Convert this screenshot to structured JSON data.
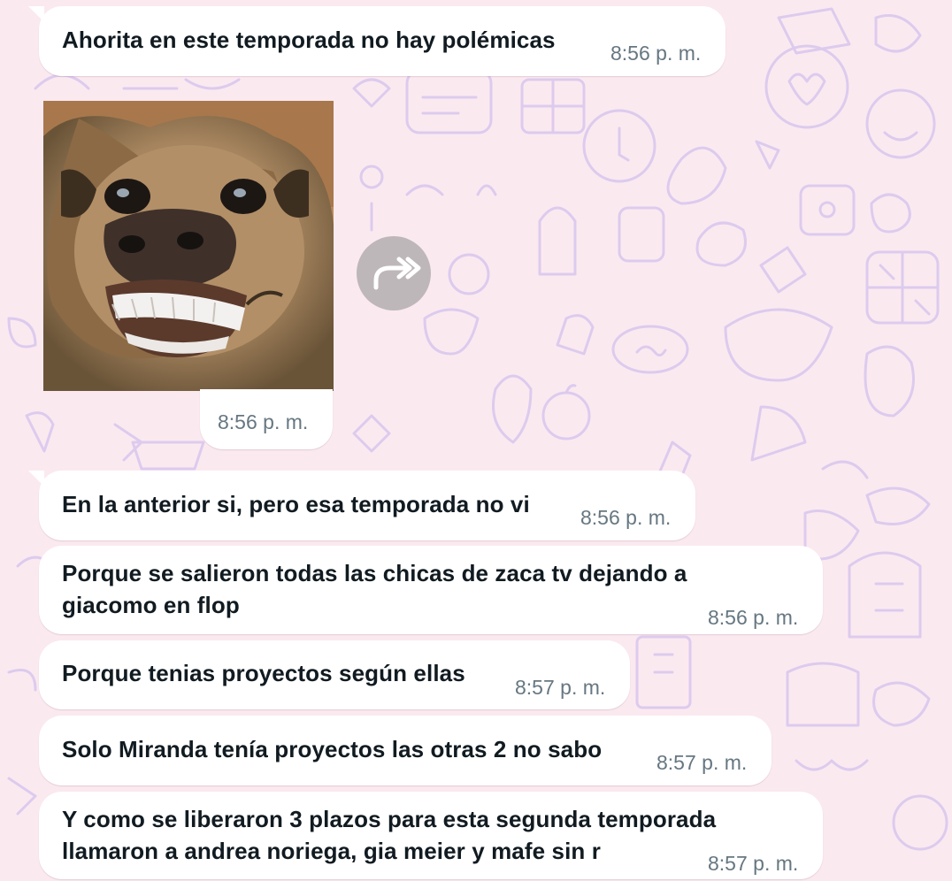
{
  "messages": [
    {
      "text": "Ahorita en este temporada no hay polémicas",
      "time": "8:56 p. m."
    },
    {
      "type": "image",
      "image": "smiling-dog-photo",
      "time": "8:56 p. m."
    },
    {
      "text": "En la anterior si, pero esa temporada no vi",
      "time": "8:56 p. m."
    },
    {
      "lines": [
        "Porque se salieron todas las chicas de zaca tv dejando a",
        "giacomo en flop"
      ],
      "time": "8:56 p. m."
    },
    {
      "text": "Porque tenias proyectos según ellas",
      "time": "8:57 p. m."
    },
    {
      "text": "Solo Miranda tenía proyectos las otras 2 no sabo",
      "time": "8:57 p. m."
    },
    {
      "lines": [
        "Y como se liberaron 3 plazos para esta segunda temporada",
        "llamaron a andrea noriega, gia meier y mafe sin r"
      ],
      "time": "8:57 p. m."
    }
  ],
  "icons": {
    "forward": "forward-arrow-icon"
  },
  "colors": {
    "wallpaper": "#fbe9f0",
    "doodle": "#d9c8ec",
    "bubble": "#ffffff",
    "text": "#111b21",
    "time": "#667781",
    "forward_button": "#9a9a9a"
  }
}
